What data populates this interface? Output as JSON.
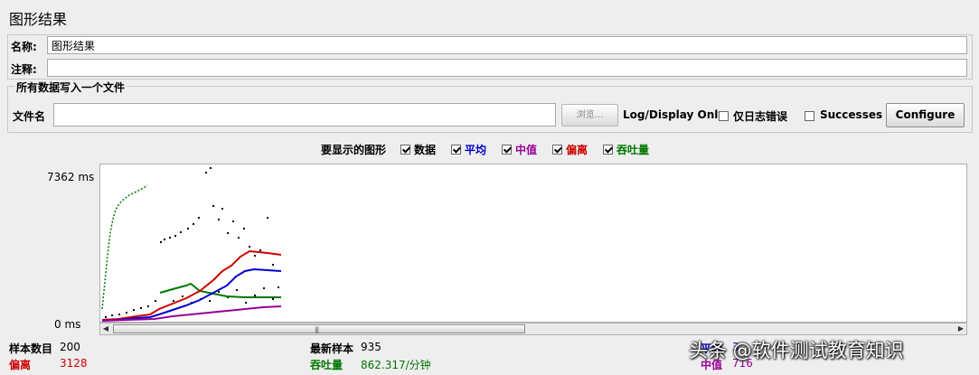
{
  "panel": {
    "title": "图形结果"
  },
  "name_row": {
    "label": "名称:",
    "value": "图形结果"
  },
  "comment_row": {
    "label": "注释:",
    "value": ""
  },
  "file_section": {
    "legend": "所有数据写入一个文件",
    "filename_label": "文件名",
    "filename_value": "",
    "browse_label": "浏览...",
    "log_display_label": "Log/Display Only:",
    "errors_only_label": "仅日志错误",
    "successes_label": "Successes",
    "configure_label": "Configure"
  },
  "graph_options": {
    "label": "要显示的图形",
    "items": [
      {
        "label": "数据",
        "checked": true,
        "color": "#000000"
      },
      {
        "label": "平均",
        "checked": true,
        "color": "#0000cc"
      },
      {
        "label": "中值",
        "checked": true,
        "color": "#990099"
      },
      {
        "label": "偏离",
        "checked": true,
        "color": "#cc0000"
      },
      {
        "label": "吞吐量",
        "checked": true,
        "color": "#007700"
      }
    ]
  },
  "graph": {
    "y_max_label": "7362  ms",
    "y_min_label": "0  ms"
  },
  "stats": {
    "sample_count_label": "样本数目",
    "sample_count_value": "200",
    "latest_sample_label": "最新样本",
    "latest_sample_value": "935",
    "deviation_label": "偏离",
    "deviation_value": "3128",
    "throughput_label": "吞吐量",
    "throughput_value": "862.317/分钟",
    "average_label": "平均",
    "average_value": "3",
    "median_label": "中值",
    "median_value": "716"
  },
  "watermark": {
    "text": "头条 @软件测试教育知识"
  }
}
